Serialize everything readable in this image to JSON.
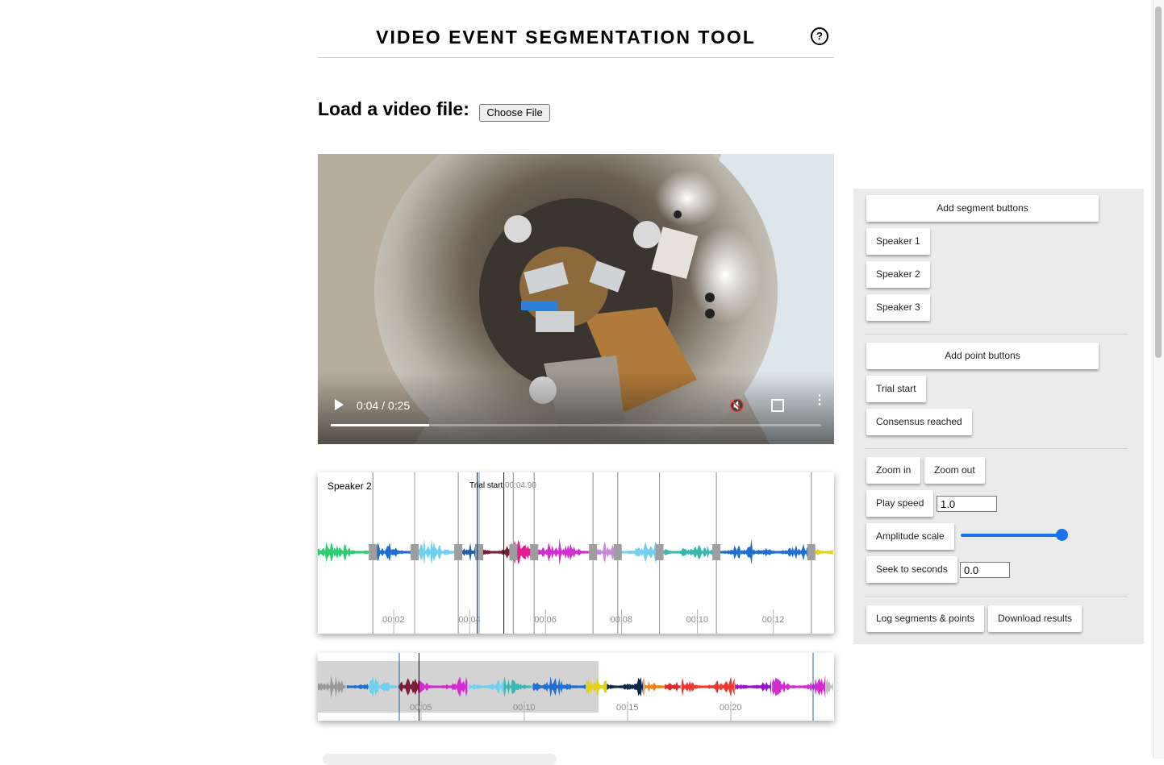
{
  "header": {
    "title": "VIDEO EVENT SEGMENTATION TOOL",
    "help_icon": "question-circle-icon",
    "help_glyph": "?"
  },
  "loader": {
    "label": "Load a video file:",
    "choose_file": "Choose File"
  },
  "video": {
    "current_time": "0:04",
    "duration": "0:25",
    "time_display": "0:04 / 0:25",
    "progress": 0.2,
    "muted": true,
    "icons": [
      "play-icon",
      "mute-icon",
      "fullscreen-icon",
      "more-vert-icon"
    ]
  },
  "zoomview": {
    "segment_label": "Speaker 2",
    "point_label": "Trial start",
    "playhead_time": "00:04.90",
    "tick_labels": [
      "00:02",
      "00:04",
      "00:06",
      "00:08",
      "00:10",
      "00:12"
    ],
    "segments": [
      {
        "start": 0.0,
        "end": 1.45,
        "color": "#2ecc71"
      },
      {
        "start": 1.45,
        "end": 2.55,
        "color": "#1f6ed4"
      },
      {
        "start": 2.55,
        "end": 3.7,
        "color": "#6fd0f2"
      },
      {
        "start": 3.7,
        "end": 4.25,
        "color": "#1f5fa8"
      },
      {
        "start": 4.25,
        "end": 5.15,
        "color": "#7a1b3a"
      },
      {
        "start": 5.15,
        "end": 5.7,
        "color": "#e0208f"
      },
      {
        "start": 5.7,
        "end": 7.25,
        "color": "#d12bd1"
      },
      {
        "start": 7.25,
        "end": 7.9,
        "color": "#c58ad6"
      },
      {
        "start": 7.9,
        "end": 9.0,
        "color": "#6fd0f2"
      },
      {
        "start": 9.0,
        "end": 10.5,
        "color": "#3ab8b0"
      },
      {
        "start": 10.5,
        "end": 13.0,
        "color": "#1f6ed4"
      },
      {
        "start": 13.0,
        "end": 13.6,
        "color": "#e6d012"
      }
    ],
    "visible_range": [
      0.0,
      13.6
    ],
    "playhead": 4.9,
    "point_time": 4.2
  },
  "overview": {
    "tick_labels": [
      "00:05",
      "00:10",
      "00:15",
      "00:20"
    ],
    "visible_range": [
      0.0,
      25.0
    ],
    "highlight_range": [
      0.0,
      13.6
    ],
    "playhead": 4.9,
    "segments": [
      {
        "start": 0.0,
        "end": 1.4,
        "color": "#999999"
      },
      {
        "start": 1.4,
        "end": 2.5,
        "color": "#1f6ed4"
      },
      {
        "start": 2.5,
        "end": 3.9,
        "color": "#6fd0f2"
      },
      {
        "start": 3.9,
        "end": 4.9,
        "color": "#7a1b3a"
      },
      {
        "start": 4.9,
        "end": 7.3,
        "color": "#d12bd1"
      },
      {
        "start": 7.3,
        "end": 9.0,
        "color": "#6fd0f2"
      },
      {
        "start": 9.0,
        "end": 10.4,
        "color": "#3ab8b0"
      },
      {
        "start": 10.4,
        "end": 13.0,
        "color": "#1f6ed4"
      },
      {
        "start": 13.0,
        "end": 14.0,
        "color": "#e6d012"
      },
      {
        "start": 14.0,
        "end": 15.8,
        "color": "#0c2a4a"
      },
      {
        "start": 15.8,
        "end": 16.8,
        "color": "#f07f1e"
      },
      {
        "start": 16.8,
        "end": 17.6,
        "color": "#e02a2a"
      },
      {
        "start": 17.6,
        "end": 20.2,
        "color": "#f0382e"
      },
      {
        "start": 20.2,
        "end": 22.0,
        "color": "#9b12c8"
      },
      {
        "start": 22.0,
        "end": 24.6,
        "color": "#d12bd1"
      },
      {
        "start": 24.6,
        "end": 25.0,
        "color": "#bdbdbd"
      }
    ]
  },
  "controls": {
    "add_segment_buttons": "Add segment buttons",
    "speakers": [
      "Speaker 1",
      "Speaker 2",
      "Speaker 3"
    ],
    "add_point_buttons": "Add point buttons",
    "points": [
      "Trial start",
      "Consensus reached"
    ],
    "zoom_in": "Zoom in",
    "zoom_out": "Zoom out",
    "play_speed_label": "Play speed",
    "play_speed_value": "1.0",
    "amplitude_label": "Amplitude scale",
    "amplitude_value": 1.0,
    "seek_label": "Seek to seconds",
    "seek_value": "0.0",
    "log_button": "Log segments & points",
    "download_button": "Download results"
  }
}
